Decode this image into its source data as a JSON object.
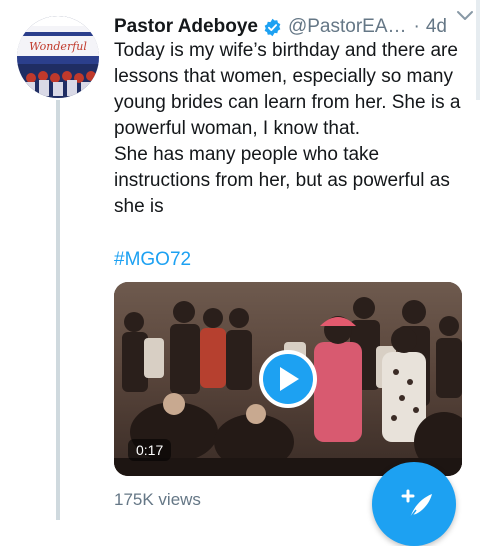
{
  "tweet": {
    "author_name": "Pastor Adeboye",
    "author_handle": "@PastorEA…",
    "separator": "·",
    "age": "4d",
    "text_paragraph_1": "Today is my wife’s birthday and there are lessons that women, especially so many young brides can learn from her. She is a powerful woman, I know that.",
    "text_paragraph_2": "She has many people who take instructions from her, but as powerful as she is",
    "hashtag": "#MGO72",
    "video_duration": "0:17",
    "views": "175K views"
  },
  "avatar": {
    "banner_text": "Wonderful"
  },
  "icons": {
    "verified": "verified-badge-icon",
    "caret": "chevron-down-icon",
    "play": "play-icon",
    "compose": "compose-tweet-icon"
  },
  "colors": {
    "accent": "#1da1f2",
    "text": "#14171a",
    "muted": "#657786",
    "thread_line": "#cfd9de"
  }
}
